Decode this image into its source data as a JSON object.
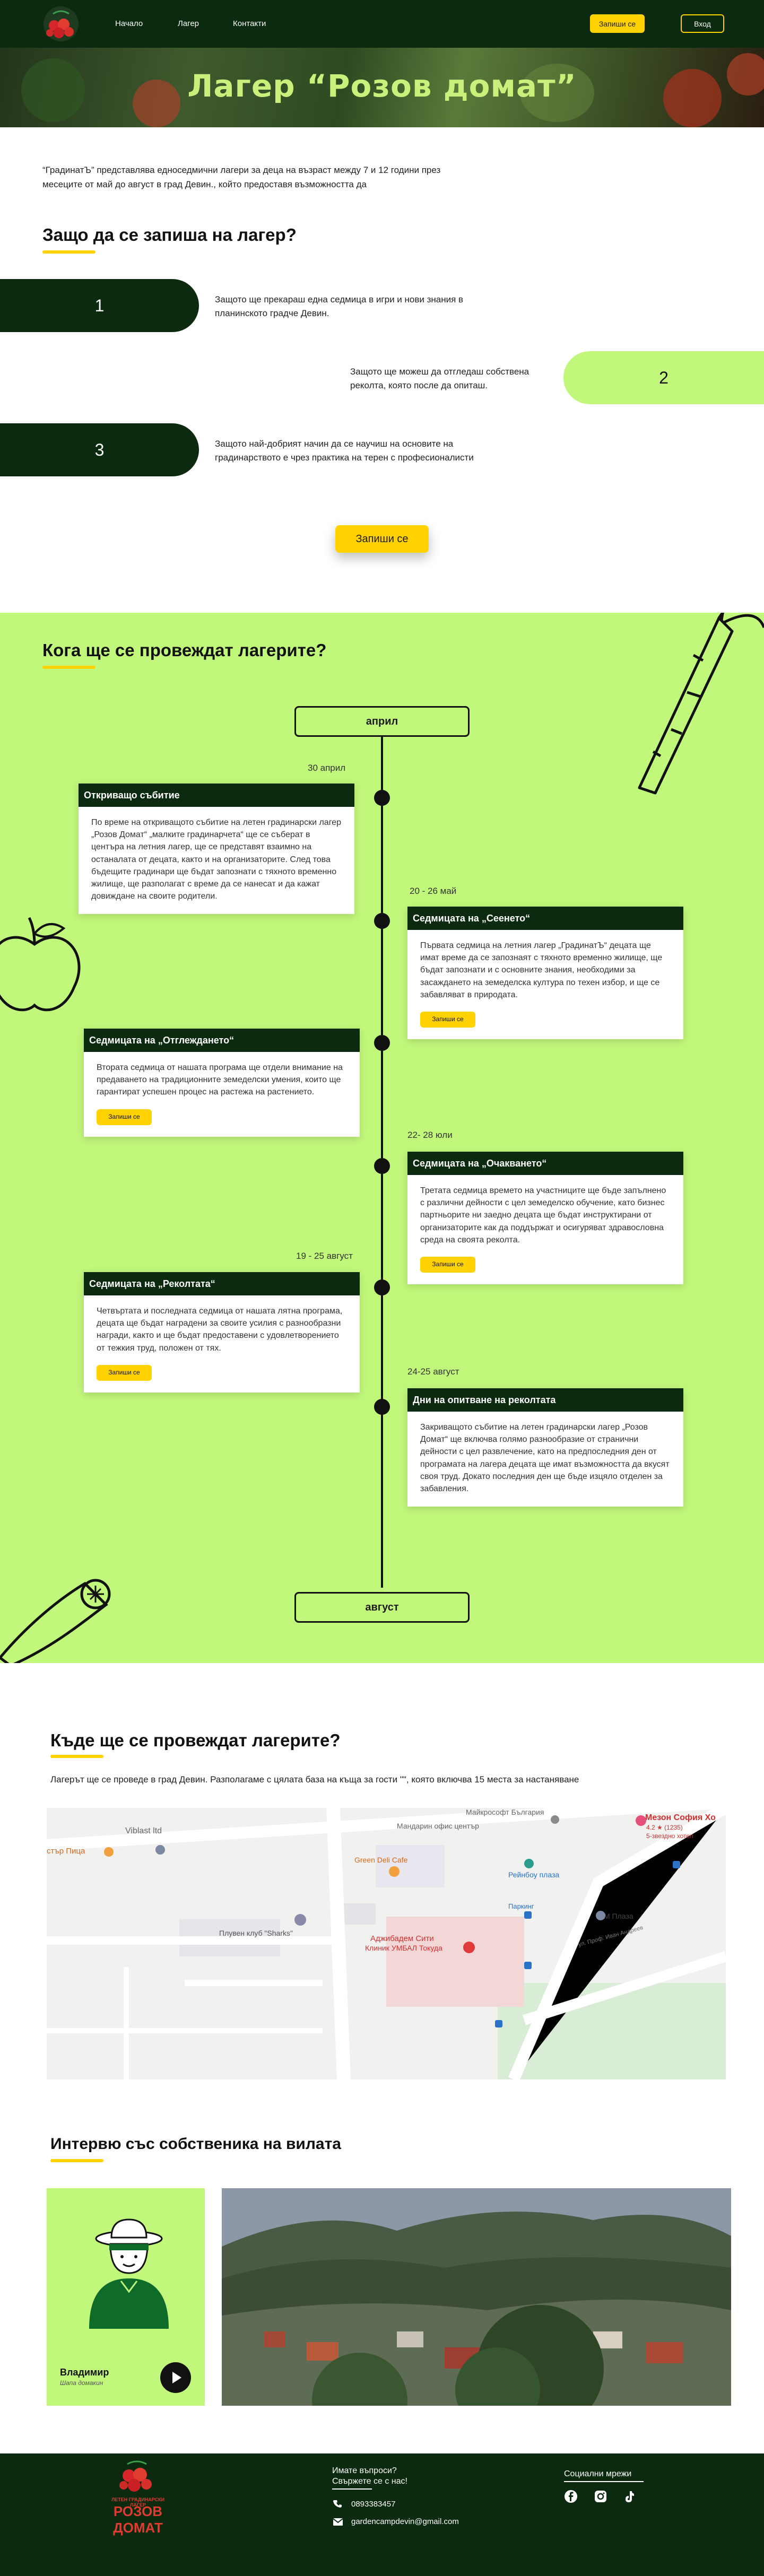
{
  "header": {
    "nav": [
      "Начало",
      "Лагер",
      "Контакти"
    ],
    "signup_label": "Запиши се",
    "login_label": "Вход"
  },
  "hero": {
    "title": "Лагер “Розов домат”"
  },
  "intro": "“ГрадинатЪ” представлява едноседмични лагери за деца на възраст между 7 и 12 години през месеците от май до август в град Девин., който предоставя възможността да",
  "why": {
    "title": "Защо да се запиша на лагер?",
    "reasons": [
      {
        "num": "1",
        "text": "Защото ще прекараш една седмица в игри и нови знания в планинското градче Девин."
      },
      {
        "num": "2",
        "text": "Защото ще можеш да отгледаш собствена реколта, която после да опиташ."
      },
      {
        "num": "3",
        "text": "Защото най-добрият начин да се научиш на основите на градинарството е чрез практика на терен с професионалисти"
      }
    ],
    "signup_label": "Запиши се"
  },
  "timeline": {
    "title": "Кога ще се провеждат лагерите?",
    "start_label": "април",
    "end_label": "август",
    "events": [
      {
        "date": "30 април",
        "title": "Откриващо събитие",
        "text": "По време на откриващото събитие на летен градинарски лагер „Розов Домат“ „малките градинарчета“ ще се съберат в центъра на летния лагер, ще се представят взаимно на останалата от децата, както и на организаторите. След това бъдещите градинари ще бъдат запознати с тяхното временно жилище, ще разполагат с време да се нанесат и да кажат довиждане на своите родители.",
        "button": ""
      },
      {
        "date": "20 - 26 май",
        "title": "Седмицата на „Сеенето“",
        "text": "Първата седмица на летния лагер „ГрадинатЪ“ децата ще имат време да се запознаят с тяхното временно жилище, ще бъдат запознати и с основните знания, необходими за засаждането на земеделска култура по техен избор, и ще се забавляват в природата.",
        "button": "Запиши се"
      },
      {
        "date": "",
        "title": "Седмицата на „Отглеждането“",
        "text": "Втората седмица от нашата програма ще отдели внимание на предаването на традиционните земеделски умения, които ще гарантират успешен процес на растежа на растението.",
        "button": "Запиши се"
      },
      {
        "date": "22- 28 юли",
        "title": "Седмицата на „Очакването“",
        "text": "Третата седмица времето на участниците ще бъде запълнено с различни дейности с цел земеделско обучение, като бизнес партньорите ни заедно децата ще бъдат инструктирани от организаторите как да поддържат и осигуряват здравословна среда на своята реколта.",
        "button": "Запиши се"
      },
      {
        "date": "19 - 25 август",
        "title": "Седмицата на „Реколтата“",
        "text": "Четвъртата и последната седмица от нашата лятна програма, децата ще бъдат наградени за своите усилия с разнообразни награди, както и ще бъдат предоставени с удовлетворението от тежкия труд, положен от тях.",
        "button": "Запиши се"
      },
      {
        "date": "24-25 август",
        "title": "Дни на опитване на реколтата",
        "text": "Закриващото събитие на летен градинарски лагер „Розов Домат“ ще включва голямо разнообразие от странични дейности с цел развлечение, като на предпоследния ден от програмата на лагера децата ще имат възможността да вкусят своя труд. Докато последния ден ще бъде изцяло отделен за забавления.",
        "button": ""
      }
    ]
  },
  "location": {
    "title": "Къде ще се провеждат лагерите?",
    "text": "Лагерът ще се проведе в град Девин. Разполагаме с цялата база на къща за гости \"\", която включва 15 места за настаняване",
    "map_labels": [
      "Viblast ltd",
      "стър Пица",
      "Майкрософт България",
      "Мезон София Хо",
      "4.2 ★ (1235)",
      "5-звездно хотел",
      "Мандарин офис център",
      "Green Deli Cafe",
      "Рейнбоу плаза",
      "Паркинг",
      "М Плаза",
      "Плувен клуб \"Sharks\"",
      "Аджибадем Сити",
      "Клиник УМБАЛ Токуда",
      "ул. Проф. Иван Андреев"
    ]
  },
  "interview": {
    "title": "Интервю със собственика на вилата",
    "name": "Владимир",
    "role": "Шапа домакин"
  },
  "footer": {
    "logo_caption": "ЛЕТЕН ГРАДИНАРСКИ ЛАГЕР",
    "logo_name": "РОЗОВ ДОМАТ",
    "questions_title": "Имате въпроси?",
    "questions_sub": "Свържете се с нас!",
    "phone": "0893383457",
    "email": "gardencampdevin@gmail.com",
    "social_title": "Социални мрежи"
  },
  "colors": {
    "dark_green": "#0b2a0f",
    "lime": "#c1f77a",
    "yellow": "#ffd200"
  }
}
